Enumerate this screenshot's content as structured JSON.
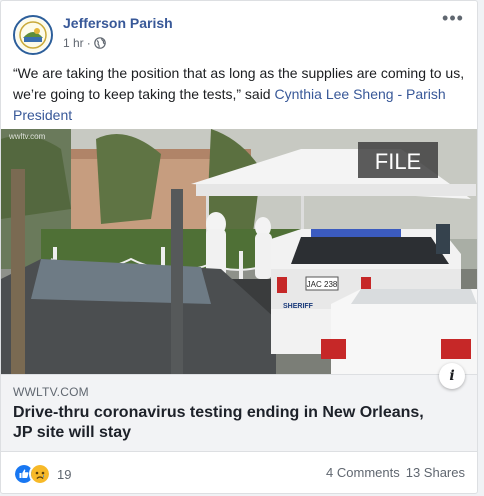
{
  "post": {
    "page_name": "Jefferson Parish",
    "time": "1 hr",
    "separator": "·",
    "more_glyph": "•••",
    "text_quote": "“We are taking the position that as long as the supplies are coming to us, we’re going to keep taking the tests,” said ",
    "mention": "Cynthia Lee Sheng - Parish President"
  },
  "media": {
    "watermark": "wwltv.com",
    "file_badge": "FILE",
    "plate": "JAC 238",
    "car_label": "SHERIFF"
  },
  "link": {
    "domain": "WWLTV.COM",
    "headline": "Drive-thru coronavirus testing ending in New Orleans, JP site will stay",
    "info_glyph": "i"
  },
  "footer": {
    "reaction_count": "19",
    "comments": "4 Comments",
    "shares": "13 Shares"
  },
  "colors": {
    "link_blue": "#385898",
    "like_blue": "#1877f2",
    "sad_yellow": "#f7b928"
  }
}
